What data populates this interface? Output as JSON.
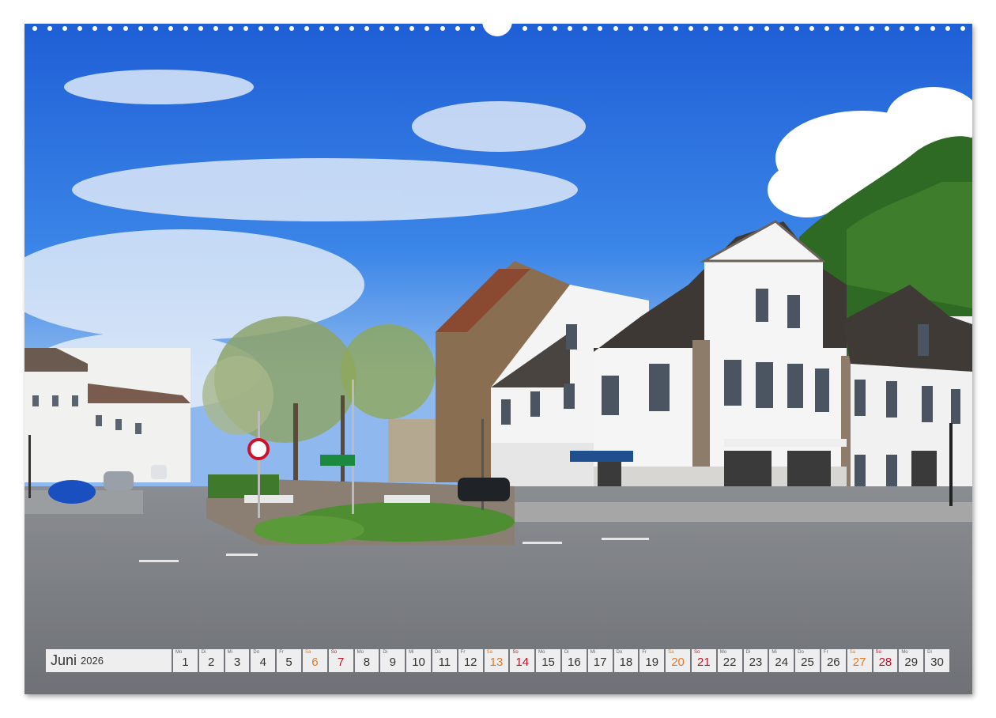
{
  "calendar": {
    "month": "Juni",
    "year": "2026",
    "colors": {
      "weekday": "#333333",
      "saturday": "#e07a2a",
      "sunday": "#c0142a",
      "cell_bg": "#eeeeee"
    },
    "days": [
      {
        "wd": "Mo",
        "d": "1",
        "type": "weekday"
      },
      {
        "wd": "Di",
        "d": "2",
        "type": "weekday"
      },
      {
        "wd": "Mi",
        "d": "3",
        "type": "weekday"
      },
      {
        "wd": "Do",
        "d": "4",
        "type": "weekday"
      },
      {
        "wd": "Fr",
        "d": "5",
        "type": "weekday"
      },
      {
        "wd": "Sa",
        "d": "6",
        "type": "sat"
      },
      {
        "wd": "So",
        "d": "7",
        "type": "sun"
      },
      {
        "wd": "Mo",
        "d": "8",
        "type": "weekday"
      },
      {
        "wd": "Di",
        "d": "9",
        "type": "weekday"
      },
      {
        "wd": "Mi",
        "d": "10",
        "type": "weekday"
      },
      {
        "wd": "Do",
        "d": "11",
        "type": "weekday"
      },
      {
        "wd": "Fr",
        "d": "12",
        "type": "weekday"
      },
      {
        "wd": "Sa",
        "d": "13",
        "type": "sat"
      },
      {
        "wd": "So",
        "d": "14",
        "type": "sun"
      },
      {
        "wd": "Mo",
        "d": "15",
        "type": "weekday"
      },
      {
        "wd": "Di",
        "d": "16",
        "type": "weekday"
      },
      {
        "wd": "Mi",
        "d": "17",
        "type": "weekday"
      },
      {
        "wd": "Do",
        "d": "18",
        "type": "weekday"
      },
      {
        "wd": "Fr",
        "d": "19",
        "type": "weekday"
      },
      {
        "wd": "Sa",
        "d": "20",
        "type": "sat"
      },
      {
        "wd": "So",
        "d": "21",
        "type": "sun"
      },
      {
        "wd": "Mo",
        "d": "22",
        "type": "weekday"
      },
      {
        "wd": "Di",
        "d": "23",
        "type": "weekday"
      },
      {
        "wd": "Mi",
        "d": "24",
        "type": "weekday"
      },
      {
        "wd": "Do",
        "d": "25",
        "type": "weekday"
      },
      {
        "wd": "Fr",
        "d": "26",
        "type": "weekday"
      },
      {
        "wd": "Sa",
        "d": "27",
        "type": "sat"
      },
      {
        "wd": "So",
        "d": "28",
        "type": "sun"
      },
      {
        "wd": "Mo",
        "d": "29",
        "type": "weekday"
      },
      {
        "wd": "Di",
        "d": "30",
        "type": "weekday"
      }
    ]
  }
}
